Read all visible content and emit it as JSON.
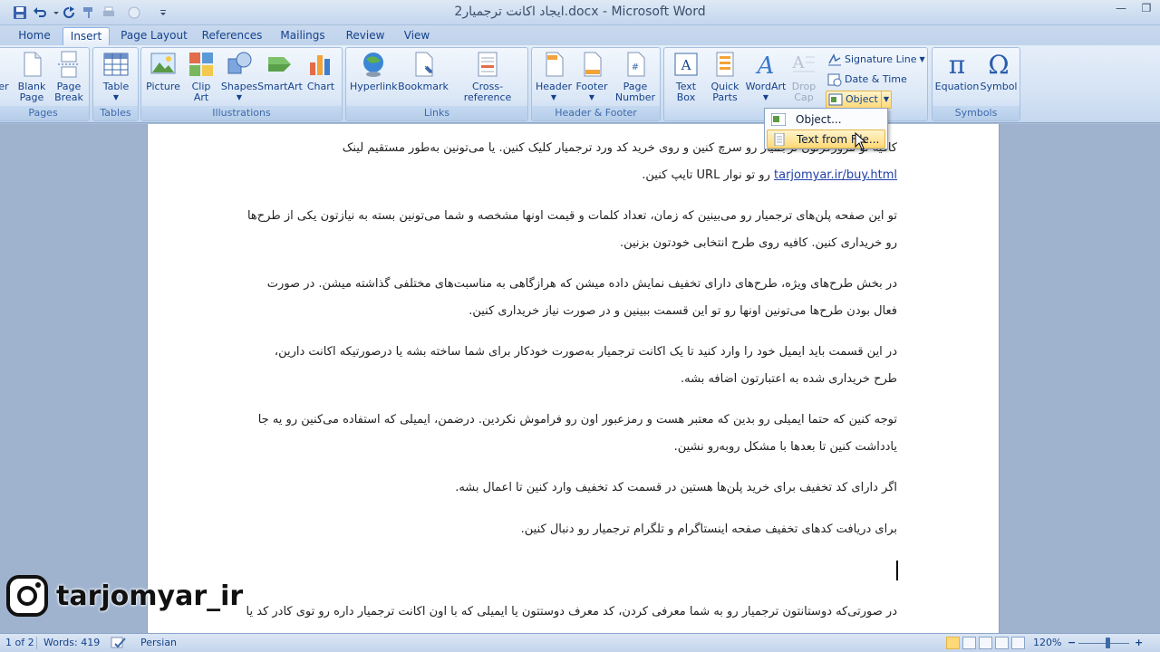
{
  "window": {
    "title": "ایجاد اکانت ترجمیار2.docx - Microsoft Word"
  },
  "tabs": [
    {
      "label": "Home"
    },
    {
      "label": "Insert",
      "active": true
    },
    {
      "label": "Page Layout"
    },
    {
      "label": "References"
    },
    {
      "label": "Mailings"
    },
    {
      "label": "Review"
    },
    {
      "label": "View"
    }
  ],
  "ribbon": {
    "pages": {
      "label": "Pages",
      "cover": "er",
      "blank": "Blank\nPage",
      "break": "Page\nBreak"
    },
    "tables": {
      "label": "Tables",
      "table": "Table"
    },
    "illustrations": {
      "label": "Illustrations",
      "picture": "Picture",
      "clipart": "Clip\nArt",
      "shapes": "Shapes",
      "smartart": "SmartArt",
      "chart": "Chart"
    },
    "links": {
      "label": "Links",
      "hyperlink": "Hyperlink",
      "bookmark": "Bookmark",
      "crossref": "Cross-reference"
    },
    "header_footer": {
      "label": "Header & Footer",
      "header": "Header",
      "footer": "Footer",
      "page_number": "Page\nNumber"
    },
    "text": {
      "textbox": "Text\nBox",
      "quickparts": "Quick\nParts",
      "wordart": "WordArt",
      "dropcap": "Drop\nCap",
      "signature": "Signature Line",
      "datetime": "Date & Time",
      "object": "Object"
    },
    "symbols": {
      "label": "Symbols",
      "equation": "Equation",
      "symbol": "Symbol"
    }
  },
  "dropdown": {
    "items": [
      {
        "label": "Object..."
      },
      {
        "label": "Text from File..."
      }
    ]
  },
  "document": {
    "p1_line1": "کافیه تو مرورگرتون ترجمیار رو سرچ کنین و روی خرید کد ورد ترجمیار کلیک کنین. یا می‌تونین به‌طور مستقیم لینک",
    "p1_link": "tarjomyar.ir/buy.html",
    "p1_tail": " رو تو نوار URL تایپ کنین.",
    "p2_line1": "تو این صفحه پلن‌های ترجمیار رو می‌بینین که زمان، تعداد کلمات و قیمت اونها مشخصه و شما می‌تونین بسته به نیازتون یکی از طرح‌ها",
    "p2_line2": "رو خریداری کنین. کافیه روی طرح انتخابی خودتون بزنین.",
    "p3_line1": "در بخش طرح‌های ویژه، طرح‌های دارای تخفیف نمایش داده میشن که هرازگاهی به مناسبت‌های مختلفی گذاشته میشن. در صورت",
    "p3_line2": "فعال بودن طرح‌ها می‌تونین اونها رو تو این قسمت ببینین و در صورت نیاز خریداری کنین.",
    "p4_line1": "در این قسمت باید ایمیل خود را وارد کنید تا یک اکانت ترجمیار به‌صورت خودکار برای شما ساخته بشه یا درصورتیکه اکانت دارین،",
    "p4_line2": "طرح خریداری شده به اعتبارتون اضافه بشه.",
    "p5_line1": "توجه کنین که حتما ایمیلی رو بدین که معتبر هست و رمزعبور اون رو فراموش نکردین. درضمن، ایمیلی که استفاده می‌کنین رو یه جا",
    "p5_line2": "یادداشت کنین تا بعدها با مشکل روبه‌رو نشین.",
    "p6": "اگر دارای کد تخفیف برای خرید پلن‌ها هستین در قسمت کد تخفیف وارد کنین تا اعمال بشه.",
    "p7": "برای دریافت کدهای تخفیف صفحه اینستاگرام و تلگرام ترجمیار رو دنبال کنین.",
    "p8": "در صورتی‌که دوستانتون ترجمیار رو به شما معرفی کردن، کد معرف دوستتون یا ایمیلی که با اون اکانت ترجمیار داره رو توی کادر کد یا"
  },
  "watermark": {
    "handle": "tarjomyar_ir"
  },
  "statusbar": {
    "page": "1 of 2",
    "words": "Words: 419",
    "language": "Persian",
    "zoom": "120%",
    "zoom_level": 0.58
  },
  "colors": {
    "accent": "#15428b",
    "hover": "#ffd978",
    "link": "#1f3fa8"
  }
}
